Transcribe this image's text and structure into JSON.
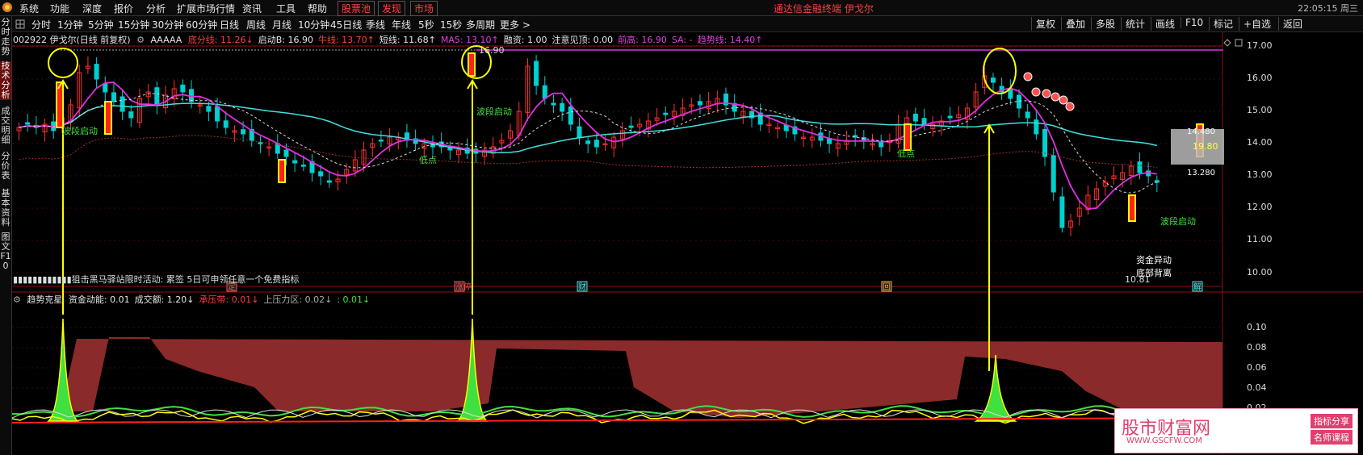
{
  "menu": {
    "items": [
      "系统",
      "功能",
      "深度",
      "报价",
      "分析",
      "扩展市场行情",
      "资讯",
      "工具",
      "帮助"
    ],
    "special": [
      "股票池",
      "发现",
      "市场"
    ],
    "center": "通达信金融终端  伊戈尔",
    "clock": "22:05:15 周三"
  },
  "toolbar": {
    "periods": [
      "分时",
      "1分钟",
      "5分钟",
      "15分钟",
      "30分钟",
      "60分钟",
      "日线",
      "周线",
      "月线",
      "10分钟",
      "45日线",
      "季线",
      "年线",
      "5秒",
      "15秒",
      "多周期",
      "更多 >"
    ],
    "right": [
      "复权",
      "叠加",
      "多股",
      "统计",
      "画线",
      "F10",
      "标记",
      "+自选",
      "返回"
    ]
  },
  "sidetabs": [
    "分时走势",
    "技术分析",
    "成交明细",
    "分价表",
    "基本资料",
    "图文F10"
  ],
  "info": {
    "stock": "002922 伊戈尔(日线 前复权)",
    "formula": "AAAAA",
    "items": [
      {
        "label": "底分线:",
        "value": "11.26↓",
        "color": "#ff4040"
      },
      {
        "label": "启动B:",
        "value": "16.90",
        "color": "#e6e6e6"
      },
      {
        "label": "牛线:",
        "value": "13.70↑",
        "color": "#ff4040"
      },
      {
        "label": "短线:",
        "value": "11.68↑",
        "color": "#e6e6e6"
      },
      {
        "label": "MA5:",
        "value": "13.10↑",
        "color": "#e040e0"
      },
      {
        "label": "融资:",
        "value": "1.00",
        "color": "#e6e6e6"
      },
      {
        "label": "注意见顶:",
        "value": "0.00",
        "color": "#e6e6e6"
      },
      {
        "label": "前高:",
        "value": "16.90",
        "color": "#e040e0"
      },
      {
        "label": "SA:",
        "value": "-",
        "color": "#e040e0"
      },
      {
        "label": "趋势线:",
        "value": "14.40↑",
        "color": "#e040e0"
      }
    ]
  },
  "notice": "▮▮▮▮▮▮▮▮▮▮▮▮狙击黑马驿站限时活动: 累签 5日可申领任意一个免费指标",
  "subinfo": {
    "name": "趋势克星",
    "items": [
      {
        "label": "资金动能:",
        "value": "0.01",
        "color": "#e6e6e6"
      },
      {
        "label": "成交额:",
        "value": "1.20↓",
        "color": "#e6e6e6"
      },
      {
        "label": "承压带:",
        "value": "0.01↓",
        "color": "#ff4040"
      },
      {
        "label": "上压力区:",
        "value": "0.02↓",
        "color": "#aaaaaa"
      },
      {
        "label": ":",
        "value": "0.01↓",
        "color": "#40e040"
      }
    ]
  },
  "price_axis": {
    "ticks": [
      "17.00",
      "16.00",
      "15.00",
      "14.00",
      "13.00",
      "12.00",
      "11.00",
      "10.00"
    ],
    "sub_ticks": [
      "0.10",
      "0.08",
      "0.06",
      "0.04",
      "0.02"
    ],
    "tag_high": "14.480",
    "tag_mid": "19.80",
    "tag_low": "13.280",
    "tag_low2": "13.23"
  },
  "annotations": {
    "wave_start": "波段启动",
    "low_point": "低点",
    "fund_anomaly": "资金异动",
    "bottom_divergence": "底部背离",
    "top_price": "16.90",
    "low_val": "10.81",
    "event_marks": [
      "定",
      "涨停",
      "财",
      "回",
      "解"
    ]
  },
  "watermark": {
    "title": "股市财富网",
    "url": "WWW.GSCFW.COM",
    "badge1": "指标分享",
    "badge2": "名师课程"
  },
  "colors": {
    "up": "#ff3030",
    "down": "#00d0d0",
    "ma_cyan": "#40e0e0",
    "ma_magenta": "#e030e0",
    "yellow": "#ffff00",
    "green": "#40e040",
    "brown": "#8b2a2a"
  }
}
